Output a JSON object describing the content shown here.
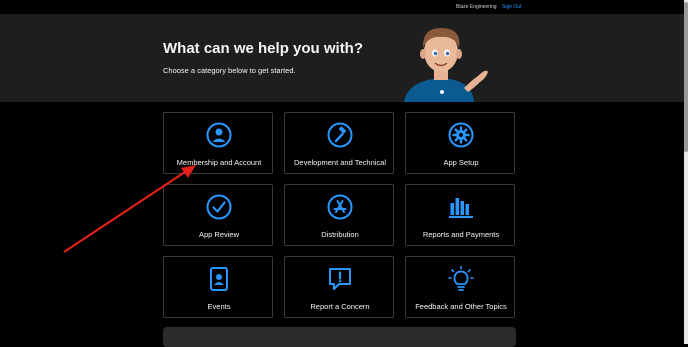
{
  "header": {
    "team_name": "Blaze Engineering",
    "sign_out_label": "Sign Out"
  },
  "hero": {
    "title": "What can we help you with?",
    "subtitle": "Choose a category below to get started."
  },
  "categories": [
    {
      "label": "Membership and Account",
      "icon": "person-circle-icon"
    },
    {
      "label": "Development and Technical",
      "icon": "hammer-icon"
    },
    {
      "label": "App Setup",
      "icon": "gear-icon"
    },
    {
      "label": "App Review",
      "icon": "checkmark-circle-icon"
    },
    {
      "label": "Distribution",
      "icon": "app-store-icon"
    },
    {
      "label": "Reports and Payments",
      "icon": "bar-chart-icon"
    },
    {
      "label": "Events",
      "icon": "badge-icon"
    },
    {
      "label": "Report a Concern",
      "icon": "exclamation-bubble-icon"
    },
    {
      "label": "Feedback and Other Topics",
      "icon": "lightbulb-icon"
    }
  ],
  "colors": {
    "accent": "#2997ff",
    "annotation_arrow": "#e0201b",
    "hero_background": "#1e1e1e",
    "page_background": "#000000"
  }
}
